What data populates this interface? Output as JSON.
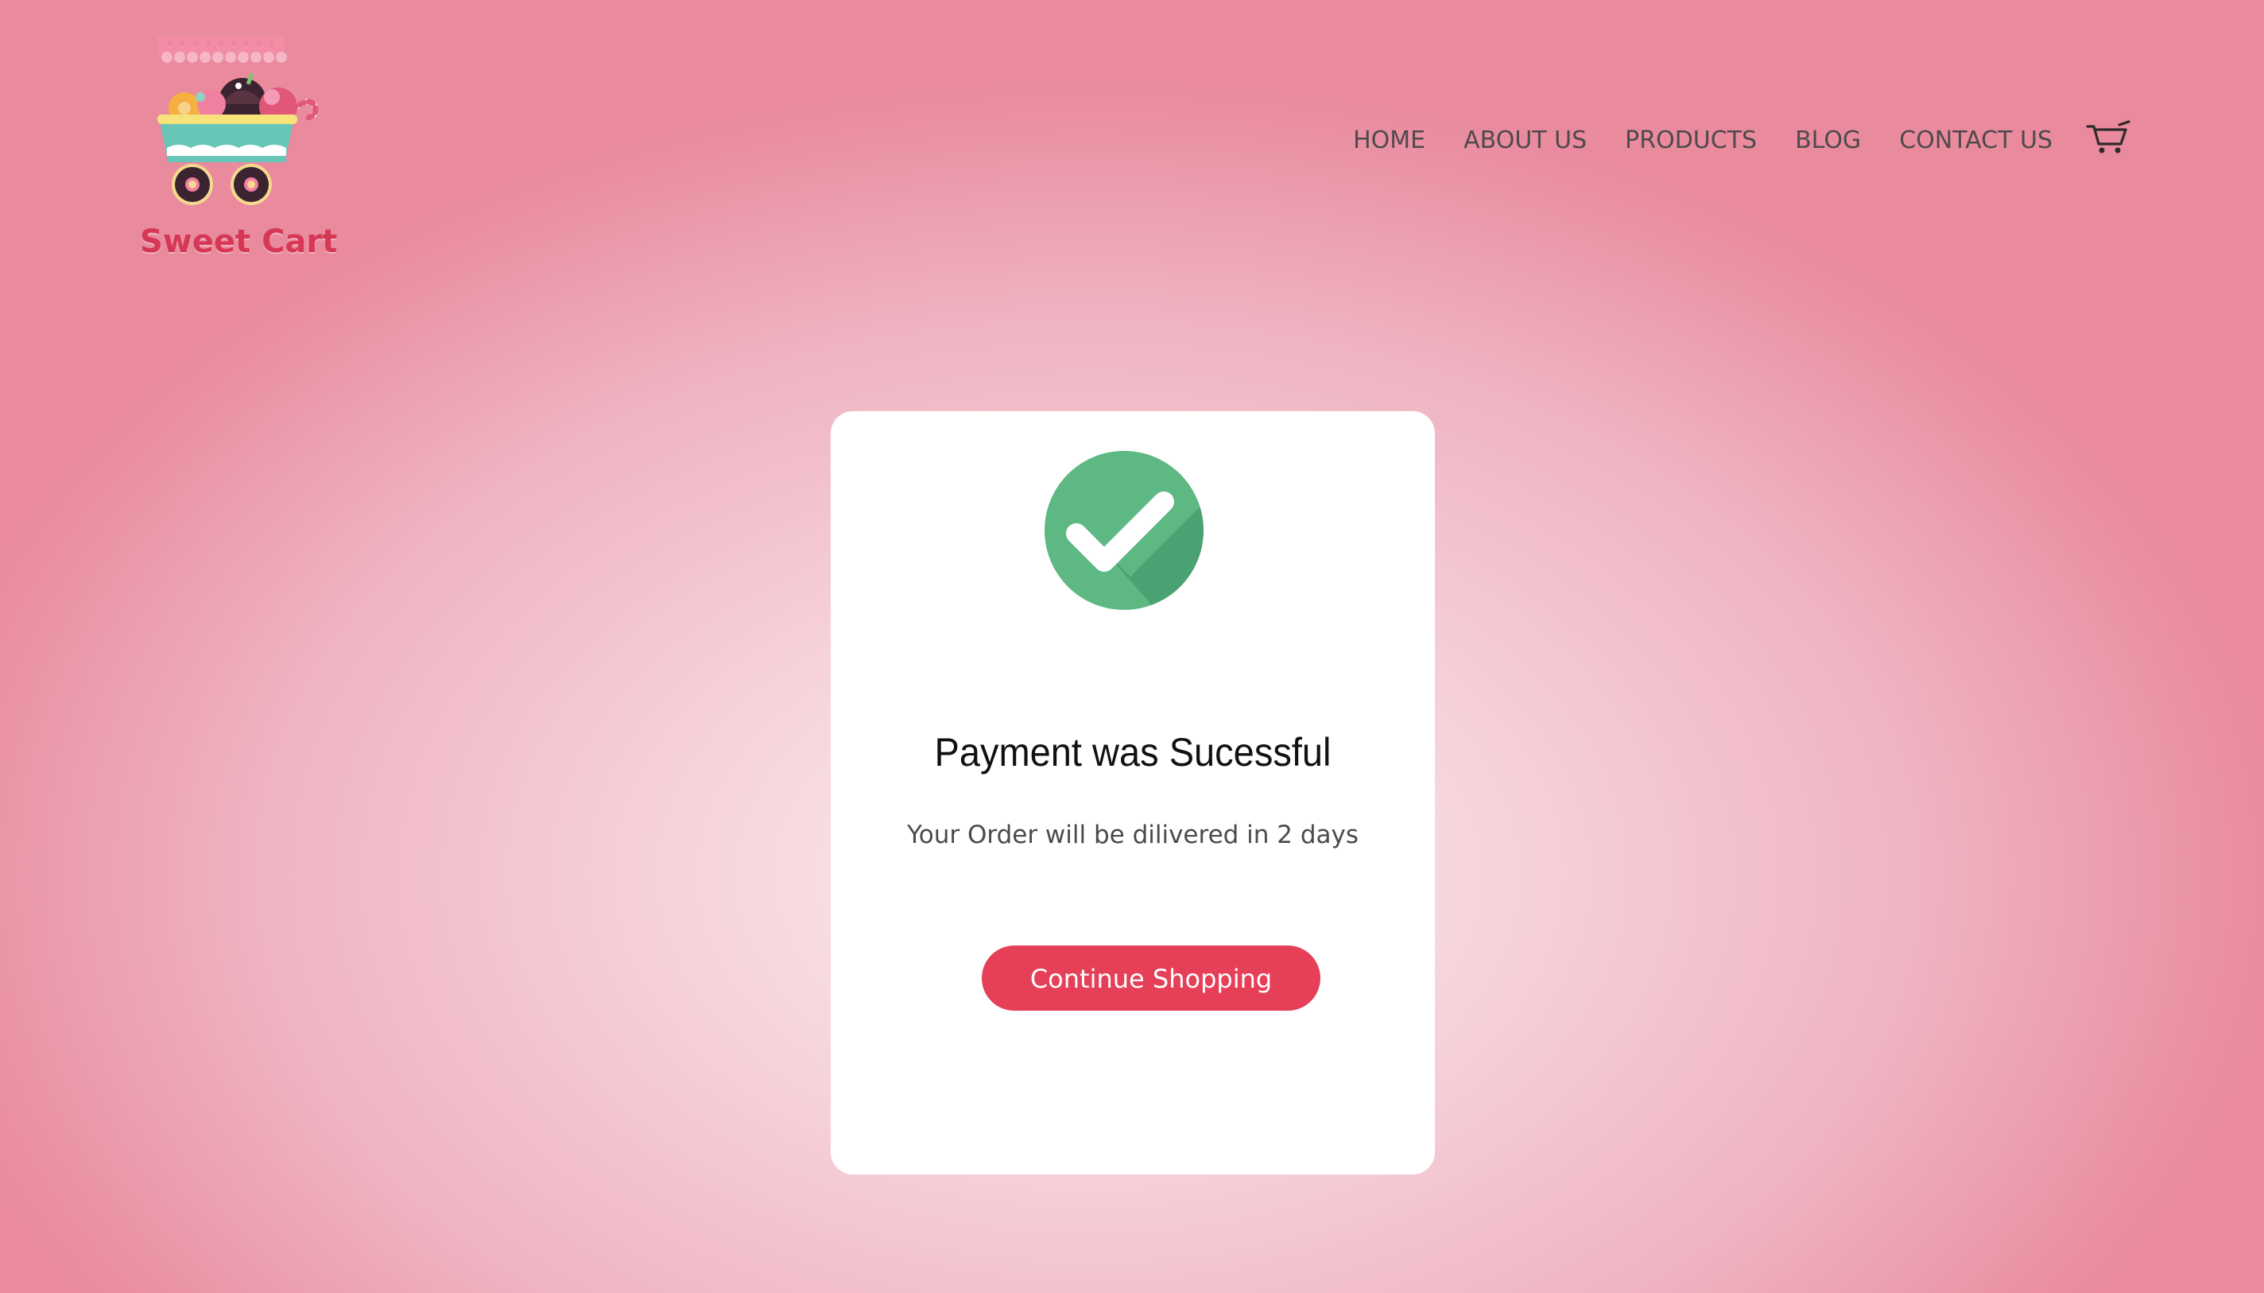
{
  "brand": {
    "name": "Sweet Cart"
  },
  "nav": {
    "items": [
      {
        "label": "HOME"
      },
      {
        "label": "ABOUT US"
      },
      {
        "label": "PRODUCTS"
      },
      {
        "label": "BLOG"
      },
      {
        "label": "CONTACT US"
      }
    ],
    "cart_icon": "shopping-cart-icon"
  },
  "confirmation": {
    "icon": "check-circle-icon",
    "title": "Payment was Sucessful",
    "message": "Your Order will be dilivered in 2 days",
    "button_label": "Continue Shopping"
  },
  "colors": {
    "accent": "#e63f58",
    "success": "#5db883",
    "success_shadow": "#4aa273",
    "brand_text": "#d63755",
    "nav_text": "#4f4a4d"
  }
}
